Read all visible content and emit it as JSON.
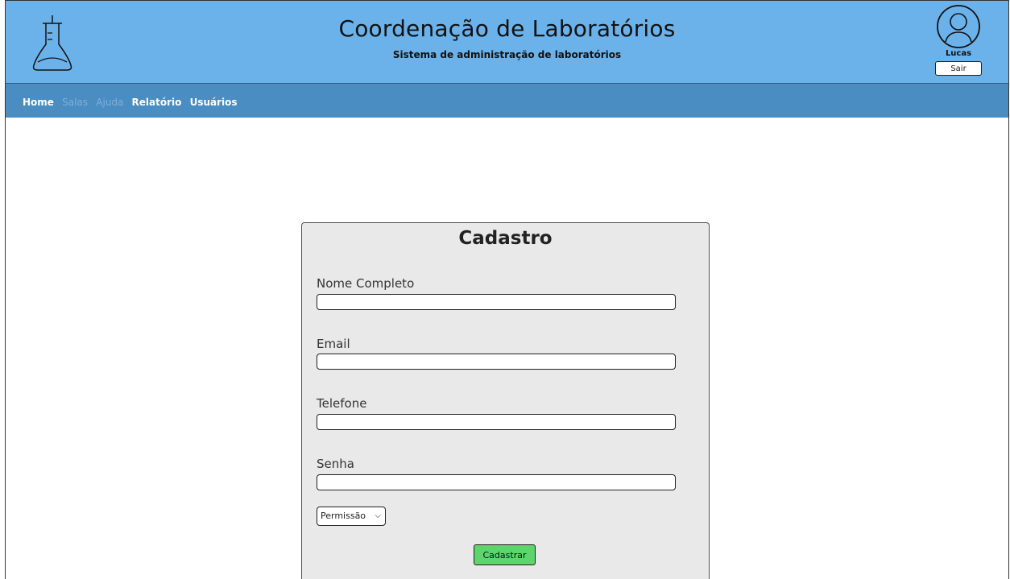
{
  "header": {
    "title": "Coordenação de Laboratórios",
    "subtitle": "Sistema de administração de laboratórios",
    "logo_icon": "flask-icon",
    "user": {
      "avatar_icon": "user-avatar-icon",
      "name": "Lucas",
      "logout_label": "Sair"
    }
  },
  "nav": {
    "items": [
      {
        "label": "Home",
        "enabled": true
      },
      {
        "label": "Salas",
        "enabled": false
      },
      {
        "label": "Ajuda",
        "enabled": false
      },
      {
        "label": "Relatório",
        "enabled": true
      },
      {
        "label": "Usuários",
        "enabled": true
      }
    ]
  },
  "form": {
    "title": "Cadastro",
    "fields": [
      {
        "label": "Nome Completo",
        "value": ""
      },
      {
        "label": "Email",
        "value": ""
      },
      {
        "label": "Telefone",
        "value": ""
      },
      {
        "label": "Senha",
        "value": ""
      }
    ],
    "permission_select": {
      "selected": "Permissão"
    },
    "submit_label": "Cadastrar"
  },
  "colors": {
    "header_bg": "#6cb2ea",
    "navbar_bg": "#4a8dc2",
    "card_bg": "#e9e9e9",
    "submit_bg": "#5ed46d"
  }
}
